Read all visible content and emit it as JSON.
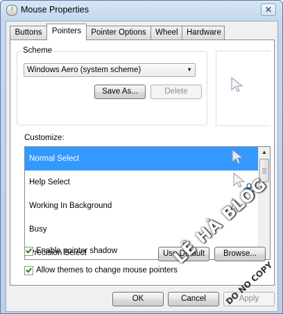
{
  "window": {
    "title": "Mouse Properties",
    "close_label": "✕"
  },
  "tabs": [
    {
      "label": "Buttons",
      "active": false
    },
    {
      "label": "Pointers",
      "active": true
    },
    {
      "label": "Pointer Options",
      "active": false
    },
    {
      "label": "Wheel",
      "active": false
    },
    {
      "label": "Hardware",
      "active": false
    }
  ],
  "scheme": {
    "group_label": "Scheme",
    "selected": "Windows Aero (system scheme)",
    "save_as_label": "Save As...",
    "delete_label": "Delete"
  },
  "customize": {
    "label": "Customize:",
    "items": [
      {
        "label": "Normal Select",
        "selected": true,
        "icon": "arrow-cursor-icon"
      },
      {
        "label": "Help Select",
        "selected": false,
        "icon": "help-cursor-icon"
      },
      {
        "label": "Working In Background",
        "selected": false,
        "icon": "arrow-cursor-icon"
      },
      {
        "label": "Busy",
        "selected": false,
        "icon": "none"
      },
      {
        "label": "Precision Select",
        "selected": false,
        "icon": "crosshair-cursor-icon"
      }
    ]
  },
  "options": {
    "pointer_shadow_label": "Enable pointer shadow",
    "pointer_shadow_checked": true,
    "themes_label": "Allow themes to change mouse pointers",
    "themes_checked": true,
    "use_default_label": "Use Default",
    "browse_label": "Browse..."
  },
  "footer": {
    "ok_label": "OK",
    "cancel_label": "Cancel",
    "apply_label": "Apply"
  },
  "watermark": {
    "main": "LÊ HÀ BLOG",
    "sub": "DO NO COPY"
  },
  "colors": {
    "selection": "#3399ff",
    "check": "#2a7a15"
  }
}
